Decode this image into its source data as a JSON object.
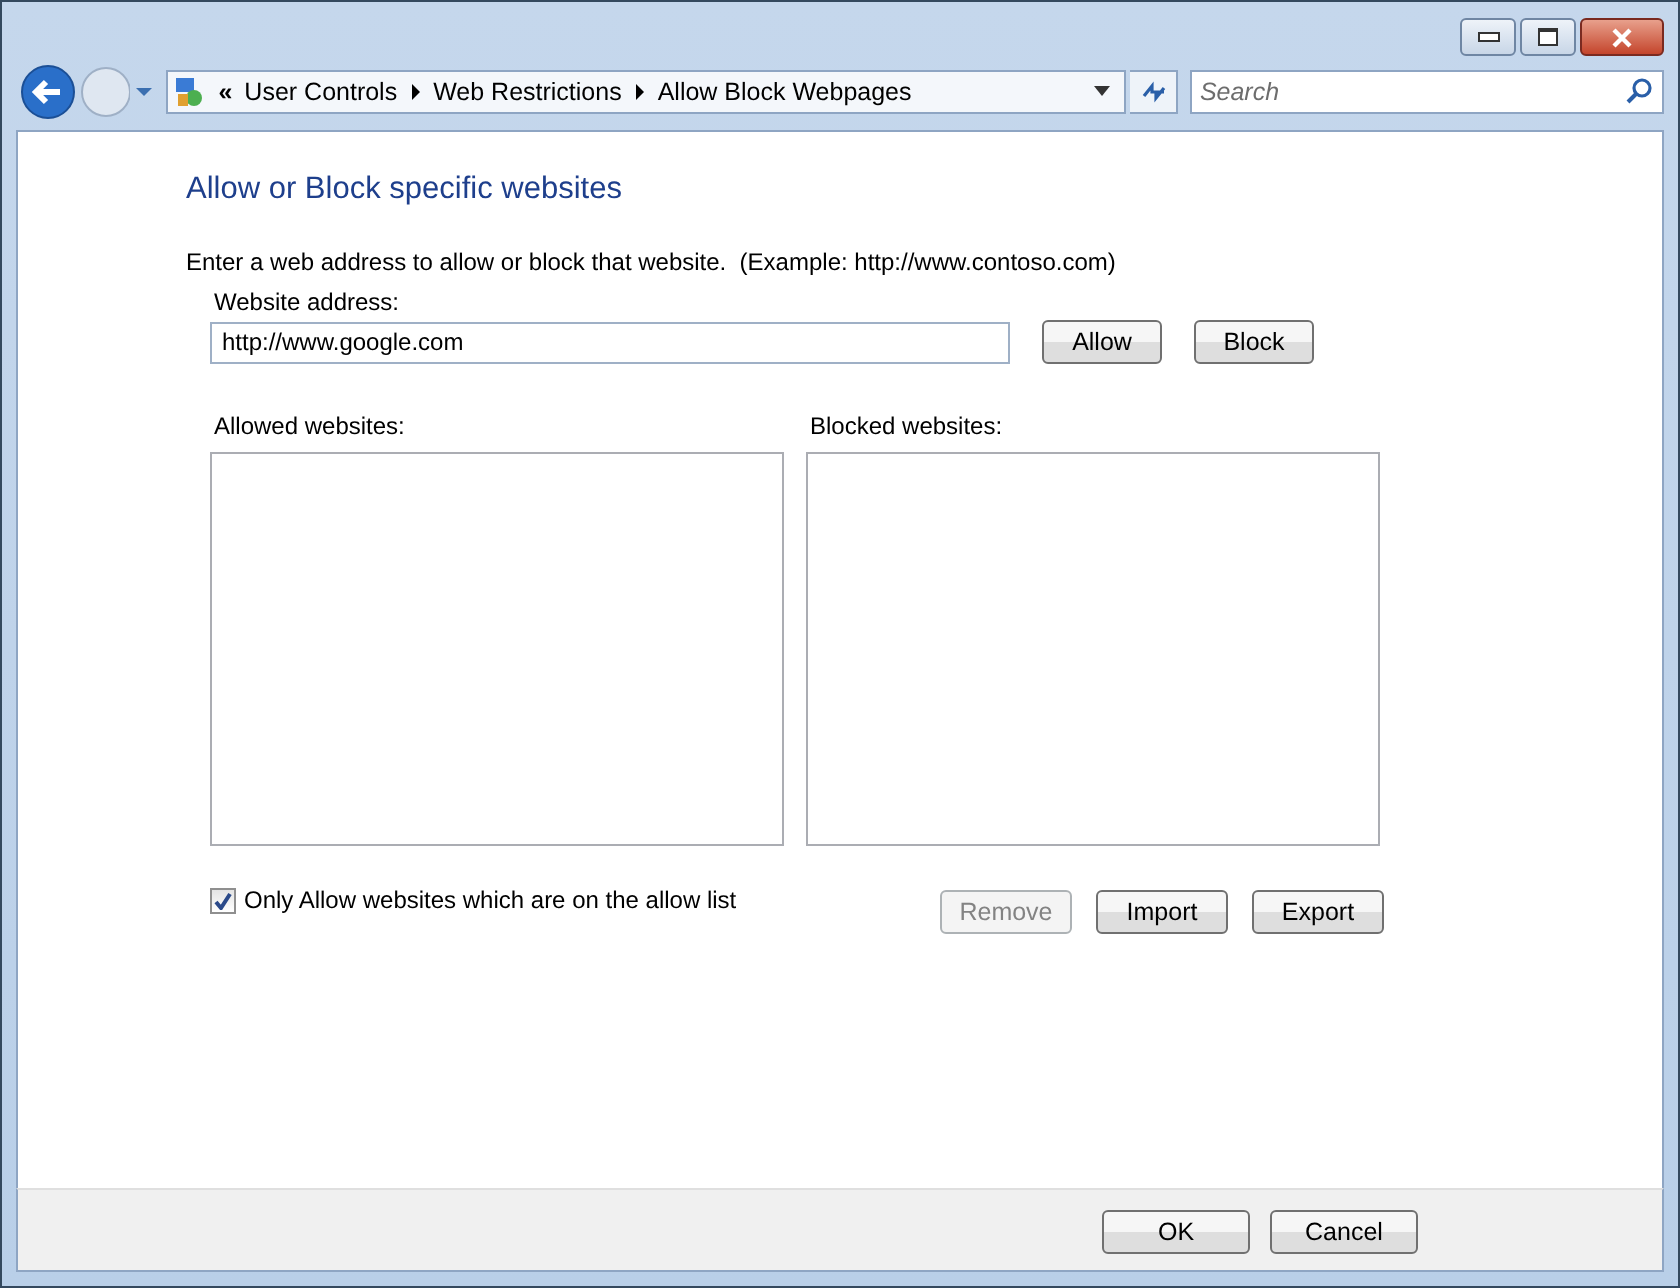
{
  "address_bar": {
    "breadcrumbs": [
      "User Controls",
      "Web Restrictions",
      "Allow Block Webpages"
    ],
    "overflow": "«"
  },
  "search": {
    "placeholder": "Search"
  },
  "heading": "Allow or Block specific websites",
  "instruction": "Enter a web address to allow or block that website.  (Example: http://www.contoso.com)",
  "address_field": {
    "label": "Website address:",
    "value": "http://www.google.com"
  },
  "address_buttons": [
    {
      "label": "Allow",
      "disabled": false
    },
    {
      "label": "Block",
      "disabled": false
    }
  ],
  "lists": [
    {
      "label": "Allowed websites:"
    },
    {
      "label": "Blocked websites:"
    }
  ],
  "only_allow": {
    "label": "Only Allow websites which are on the allow list",
    "checked": true
  },
  "list_buttons": [
    {
      "label": "Remove",
      "disabled": true
    },
    {
      "label": "Import",
      "disabled": false
    },
    {
      "label": "Export",
      "disabled": false
    }
  ],
  "footer_buttons": [
    {
      "label": "OK",
      "disabled": false
    },
    {
      "label": "Cancel",
      "disabled": false
    }
  ]
}
